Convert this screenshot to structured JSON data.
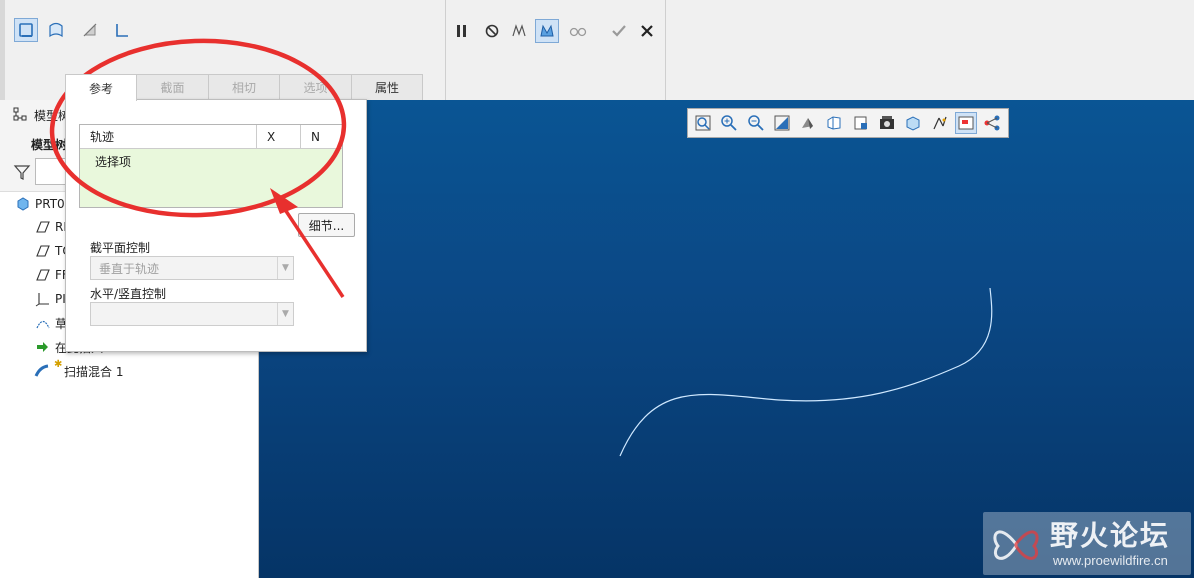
{
  "tabs": [
    {
      "label": "参考",
      "active": true
    },
    {
      "label": "截面",
      "active": false
    },
    {
      "label": "相切",
      "active": false
    },
    {
      "label": "选项",
      "active": false
    },
    {
      "label": "属性",
      "active": false
    }
  ],
  "model_tree": {
    "title": "模型树",
    "section_label": "模型树",
    "items": [
      {
        "label": "PRT0",
        "icon": "part-icon"
      },
      {
        "label": "RI",
        "icon": "datum-plane-icon"
      },
      {
        "label": "TO",
        "icon": "datum-plane-icon"
      },
      {
        "label": "FF",
        "icon": "datum-plane-icon"
      },
      {
        "label": "PI",
        "icon": "csys-icon"
      },
      {
        "label": "草",
        "icon": "sketch-icon"
      },
      {
        "label": "在此插入",
        "icon": "insert-here-icon"
      },
      {
        "label": "扫描混合 1",
        "icon": "sweep-blend-icon"
      }
    ]
  },
  "reference_panel": {
    "collector_columns": [
      "轨迹",
      "X",
      "N"
    ],
    "collector_placeholder": "选择项",
    "details_button": "细节...",
    "section_plane_label": "截平面控制",
    "section_plane_value": "垂直于轨迹",
    "horiz_vert_label": "水平/竖直控制",
    "horiz_vert_value": ""
  },
  "watermark": {
    "title": "野火论坛",
    "url": "www.proewildfire.cn"
  },
  "colors": {
    "graphics_bg": "#0b4885",
    "annotation": "#e8302e",
    "collector_bg": "#e9f8dc",
    "curve": "#d6ecff"
  }
}
